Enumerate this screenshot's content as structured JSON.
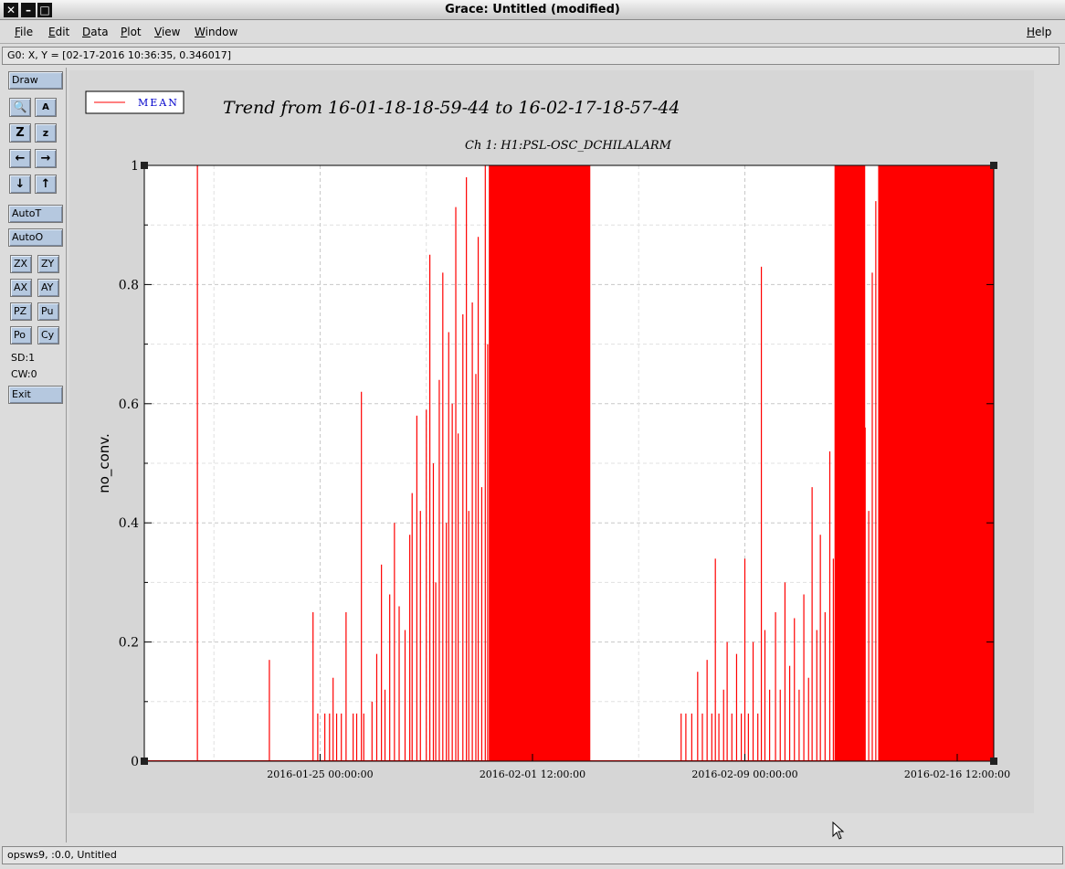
{
  "window": {
    "title": "Grace: Untitled (modified)"
  },
  "menu": [
    "File",
    "Edit",
    "Data",
    "Plot",
    "View",
    "Window"
  ],
  "menu_help": "Help",
  "locator": "G0: X, Y = [02-17-2016 10:36:35, 0.346017]",
  "toolbar": {
    "draw": "Draw",
    "autot": "AutoT",
    "autoo": "AutoO",
    "zx": "ZX",
    "zy": "ZY",
    "ax": "AX",
    "ay": "AY",
    "pz": "PZ",
    "pu": "Pu",
    "po": "Po",
    "cy": "Cy",
    "sd": "SD:1",
    "cw": "CW:0",
    "exit": "Exit"
  },
  "status": "opsws9, :0.0, Untitled",
  "colors": {
    "series": "#ff0000",
    "legend_text": "#0000cc"
  },
  "chart_data": {
    "type": "line",
    "title": "Trend from 16-01-18-18-59-44 to 16-02-17-18-57-44",
    "subtitle": "Ch 1: H1:PSL-OSC_DCHILALARM",
    "xlabel": "",
    "ylabel": "no_conv.",
    "xlim": [
      "2016-01-18 18:59:44",
      "2016-02-17 18:57:44"
    ],
    "ylim": [
      0,
      1
    ],
    "x_tick_labels": [
      "2016-01-25 00:00:00",
      "2016-02-01 12:00:00",
      "2016-02-09 00:00:00",
      "2016-02-16 12:00:00"
    ],
    "y_tick_labels": [
      "0",
      "0.2",
      "0.4",
      "0.6",
      "0.8",
      "1"
    ],
    "grid": true,
    "legend_position": "top-left",
    "series": [
      {
        "name": "MEAN",
        "x_units": "hours after 2016-01-18 18:59:44",
        "spikes": [
          [
            45,
            1.0
          ],
          [
            106,
            0.17
          ],
          [
            143,
            0.25
          ],
          [
            147,
            0.08
          ],
          [
            153,
            0.08
          ],
          [
            157,
            0.08
          ],
          [
            160,
            0.14
          ],
          [
            163,
            0.08
          ],
          [
            167,
            0.08
          ],
          [
            171,
            0.25
          ],
          [
            177,
            0.08
          ],
          [
            180,
            0.08
          ],
          [
            184,
            0.62
          ],
          [
            186,
            0.08
          ],
          [
            193,
            0.1
          ],
          [
            197,
            0.18
          ],
          [
            201,
            0.33
          ],
          [
            204,
            0.12
          ],
          [
            208,
            0.28
          ],
          [
            212,
            0.4
          ],
          [
            216,
            0.26
          ],
          [
            221,
            0.22
          ],
          [
            225,
            0.38
          ],
          [
            227,
            0.45
          ],
          [
            231,
            0.58
          ],
          [
            234,
            0.42
          ],
          [
            239,
            0.59
          ],
          [
            242,
            0.85
          ],
          [
            245,
            0.5
          ],
          [
            247,
            0.3
          ],
          [
            250,
            0.64
          ],
          [
            253,
            0.82
          ],
          [
            256,
            0.4
          ],
          [
            258,
            0.72
          ],
          [
            261,
            0.6
          ],
          [
            264,
            0.93
          ],
          [
            266,
            0.55
          ],
          [
            270,
            0.75
          ],
          [
            273,
            0.98
          ],
          [
            275,
            0.42
          ],
          [
            278,
            0.77
          ],
          [
            281,
            0.65
          ],
          [
            283,
            0.88
          ],
          [
            286,
            0.46
          ],
          [
            289,
            1.0
          ],
          [
            291,
            0.7
          ],
          [
            294,
            1.0
          ],
          [
            297,
            0.48
          ],
          [
            299,
            0.97
          ],
          [
            302,
            1.0
          ],
          [
            304,
            0.82
          ],
          [
            307,
            0.72
          ],
          [
            309,
            0.9
          ],
          [
            312,
            1.0
          ],
          [
            315,
            0.66
          ],
          [
            318,
            1.0
          ],
          [
            320,
            0.92
          ],
          [
            323,
            1.0
          ],
          [
            325,
            0.78
          ],
          [
            328,
            1.0
          ],
          [
            331,
            0.86
          ],
          [
            334,
            1.0
          ],
          [
            337,
            1.0
          ],
          [
            340,
            0.94
          ],
          [
            343,
            1.0
          ],
          [
            346,
            1.0
          ],
          [
            350,
            0.97
          ],
          [
            354,
            1.0
          ],
          [
            358,
            1.0
          ],
          [
            361,
            0.95
          ],
          [
            364,
            1.0
          ],
          [
            368,
            1.0
          ],
          [
            371,
            0.88
          ],
          [
            455,
            0.08
          ],
          [
            459,
            0.08
          ],
          [
            464,
            0.08
          ],
          [
            469,
            0.15
          ],
          [
            473,
            0.08
          ],
          [
            477,
            0.17
          ],
          [
            481,
            0.08
          ],
          [
            484,
            0.34
          ],
          [
            487,
            0.08
          ],
          [
            491,
            0.12
          ],
          [
            494,
            0.2
          ],
          [
            498,
            0.08
          ],
          [
            502,
            0.18
          ],
          [
            506,
            0.08
          ],
          [
            509,
            0.34
          ],
          [
            512,
            0.08
          ],
          [
            516,
            0.2
          ],
          [
            520,
            0.08
          ],
          [
            523,
            0.83
          ],
          [
            526,
            0.22
          ],
          [
            530,
            0.12
          ],
          [
            535,
            0.25
          ],
          [
            539,
            0.12
          ],
          [
            543,
            0.3
          ],
          [
            547,
            0.16
          ],
          [
            551,
            0.24
          ],
          [
            555,
            0.12
          ],
          [
            559,
            0.28
          ],
          [
            563,
            0.14
          ],
          [
            566,
            0.46
          ],
          [
            570,
            0.22
          ],
          [
            573,
            0.38
          ],
          [
            577,
            0.25
          ],
          [
            581,
            0.52
          ],
          [
            584,
            0.34
          ],
          [
            588,
            0.4
          ],
          [
            591,
            0.2
          ],
          [
            595,
            0.42
          ],
          [
            598,
            0.32
          ],
          [
            601,
            0.38
          ],
          [
            604,
            0.3
          ],
          [
            608,
            0.9
          ],
          [
            611,
            0.56
          ],
          [
            614,
            0.42
          ],
          [
            617,
            0.82
          ],
          [
            620,
            0.94
          ],
          [
            623,
            0.6
          ],
          [
            626,
            1.0
          ],
          [
            629,
            0.86
          ],
          [
            632,
            1.0
          ],
          [
            635,
            0.92
          ],
          [
            638,
            1.0
          ],
          [
            641,
            1.0
          ],
          [
            645,
            0.96
          ],
          [
            649,
            1.0
          ],
          [
            653,
            1.0
          ],
          [
            657,
            0.94
          ],
          [
            661,
            1.0
          ],
          [
            665,
            1.0
          ],
          [
            669,
            0.97
          ],
          [
            673,
            1.0
          ],
          [
            677,
            1.0
          ],
          [
            681,
            0.95
          ],
          [
            685,
            1.0
          ],
          [
            689,
            1.0
          ],
          [
            693,
            0.98
          ],
          [
            697,
            1.0
          ],
          [
            701,
            0.88
          ],
          [
            705,
            1.0
          ],
          [
            709,
            1.0
          ],
          [
            713,
            0.96
          ],
          [
            717,
            1.0
          ]
        ],
        "filled_bands": [
          [
            292,
            378
          ],
          [
            585,
            611
          ],
          [
            622,
            719.97
          ]
        ]
      }
    ]
  }
}
